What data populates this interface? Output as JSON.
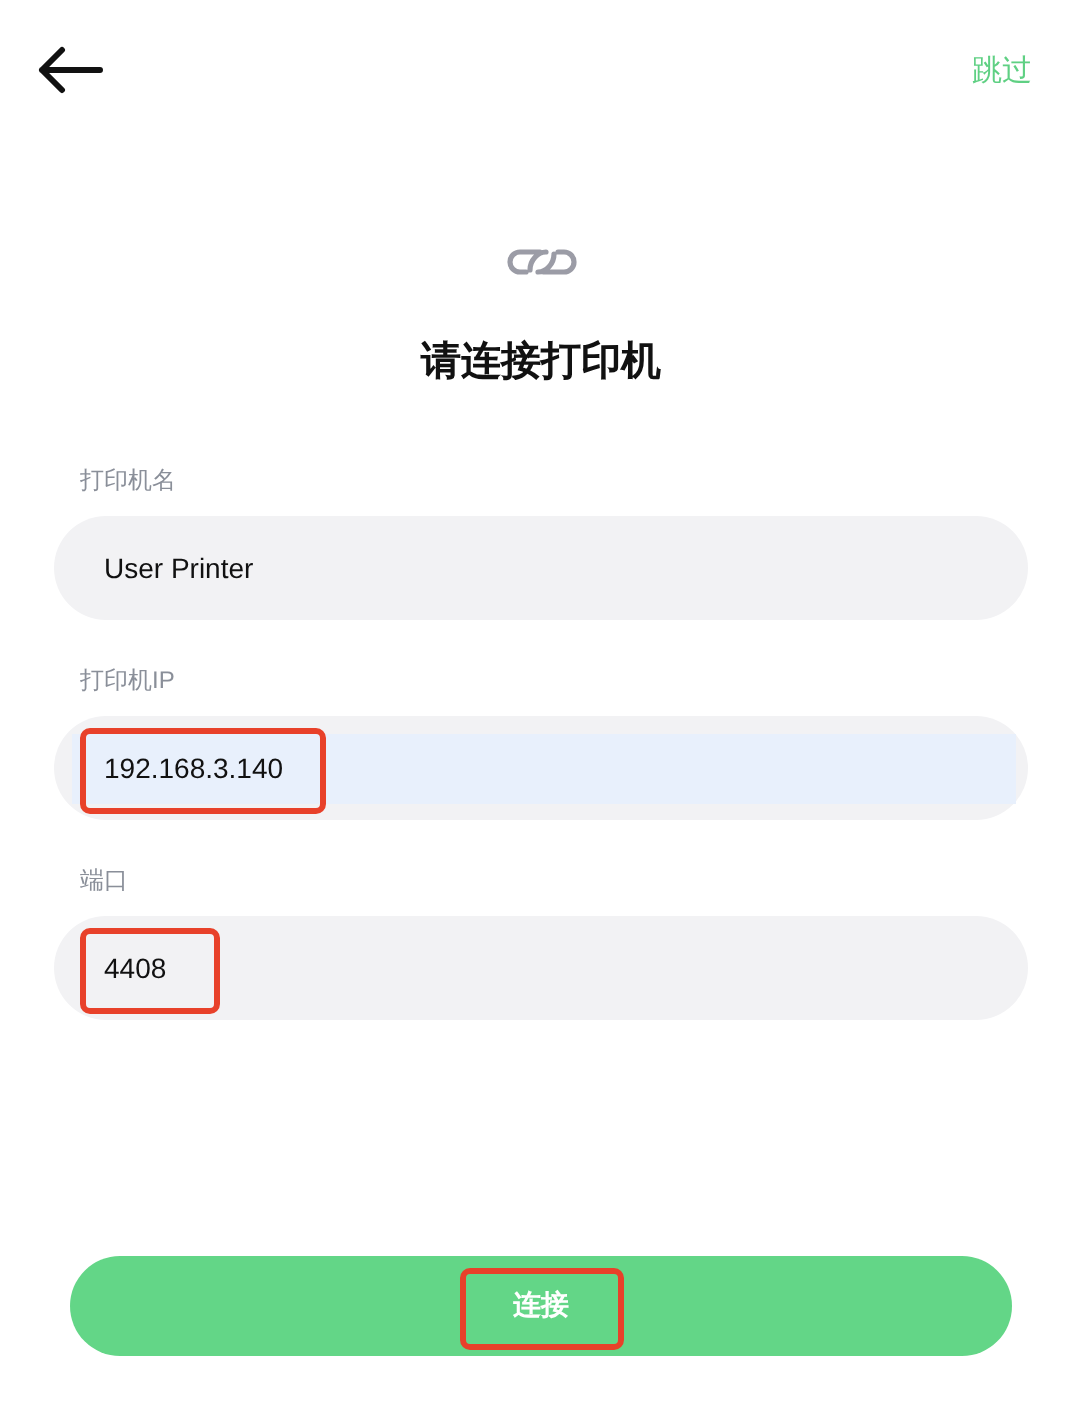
{
  "header": {
    "skip_label": "跳过"
  },
  "title": "请连接打印机",
  "fields": [
    {
      "label": "打印机名",
      "value": "User Printer",
      "autofilled": false,
      "highlighted": false
    },
    {
      "label": "打印机IP",
      "value": "192.168.3.140",
      "autofilled": true,
      "highlighted": true
    },
    {
      "label": "端口",
      "value": "4408",
      "autofilled": false,
      "highlighted": true
    }
  ],
  "connect_button": {
    "label": "连接",
    "highlighted": true
  }
}
